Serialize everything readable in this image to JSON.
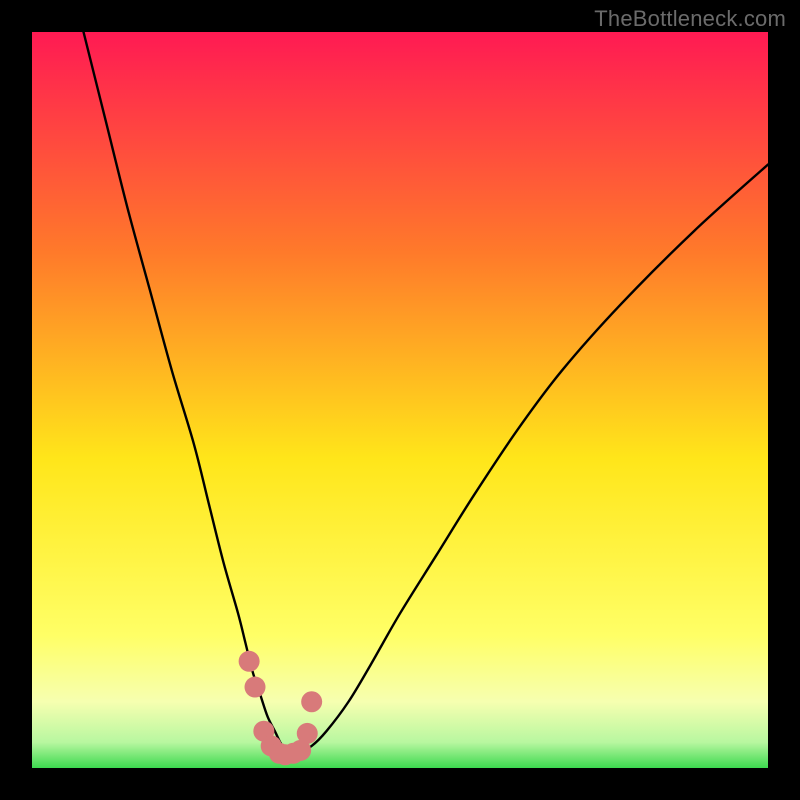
{
  "watermark": "TheBottleneck.com",
  "colors": {
    "frame": "#000000",
    "curve": "#000000",
    "marker_fill": "#d87a7a",
    "marker_stroke": "#c86868",
    "green_band": "#3dd94f",
    "gradient_top": "#ff1a53",
    "gradient_mid1": "#ff7a2a",
    "gradient_mid2": "#ffe61a",
    "gradient_low": "#f6ffb0",
    "gradient_bottom": "#3dd94f"
  },
  "chart_data": {
    "type": "line",
    "title": "",
    "xlabel": "",
    "ylabel": "",
    "xlim": [
      0,
      100
    ],
    "ylim": [
      0,
      100
    ],
    "series": [
      {
        "name": "bottleneck-curve",
        "x": [
          7,
          10,
          13,
          16,
          19,
          22,
          24,
          26,
          28,
          29,
          30,
          31,
          32,
          33,
          34,
          35,
          36,
          38,
          40,
          43,
          46,
          50,
          55,
          60,
          66,
          72,
          80,
          90,
          100
        ],
        "y": [
          100,
          88,
          76,
          65,
          54,
          44,
          36,
          28,
          21,
          17,
          13,
          10,
          7,
          5,
          3,
          2,
          2,
          3,
          5,
          9,
          14,
          21,
          29,
          37,
          46,
          54,
          63,
          73,
          82
        ]
      }
    ],
    "markers": {
      "name": "highlighted-points",
      "x": [
        29.5,
        30.3,
        31.5,
        32.5,
        33.6,
        34.4,
        35.5,
        36.5,
        37.4,
        38.0
      ],
      "y": [
        14.5,
        11.0,
        5.0,
        3.0,
        2.0,
        1.8,
        2.0,
        2.4,
        4.7,
        9.0
      ]
    },
    "gradient_stops": [
      {
        "pos": 0.0,
        "color": "#ff1a53"
      },
      {
        "pos": 0.3,
        "color": "#ff7a2a"
      },
      {
        "pos": 0.58,
        "color": "#ffe61a"
      },
      {
        "pos": 0.82,
        "color": "#ffff66"
      },
      {
        "pos": 0.91,
        "color": "#f6ffb0"
      },
      {
        "pos": 0.965,
        "color": "#b8f7a0"
      },
      {
        "pos": 1.0,
        "color": "#3dd94f"
      }
    ]
  }
}
